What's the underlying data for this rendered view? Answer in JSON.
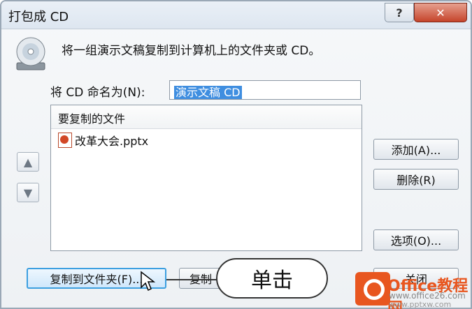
{
  "window": {
    "title": "打包成 CD",
    "help_glyph": "?",
    "close_glyph": "✕"
  },
  "intro_text": "将一组演示文稿复制到计算机上的文件夹或 CD。",
  "cd_name": {
    "label": "将 CD 命名为(N):",
    "value": "演示文稿 CD"
  },
  "file_list": {
    "header": "要复制的文件",
    "items": [
      {
        "name": "改革大会.pptx",
        "icon": "pptx-file-icon"
      }
    ]
  },
  "side_buttons": {
    "add": "添加(A)...",
    "remove": "删除(R)",
    "options": "选项(O)..."
  },
  "bottom_buttons": {
    "copy_to_folder": "复制到文件夹(F)...",
    "copy_to_cd": "复制",
    "close": "关闭"
  },
  "callout": {
    "text": "单击"
  },
  "watermark": {
    "brand": "Office教程网",
    "url": "www.office26.com",
    "url2": "www.pptxw.com"
  },
  "colors": {
    "accent": "#3c9fe0",
    "close_button": "#c5442b",
    "watermark": "#e8561f"
  }
}
